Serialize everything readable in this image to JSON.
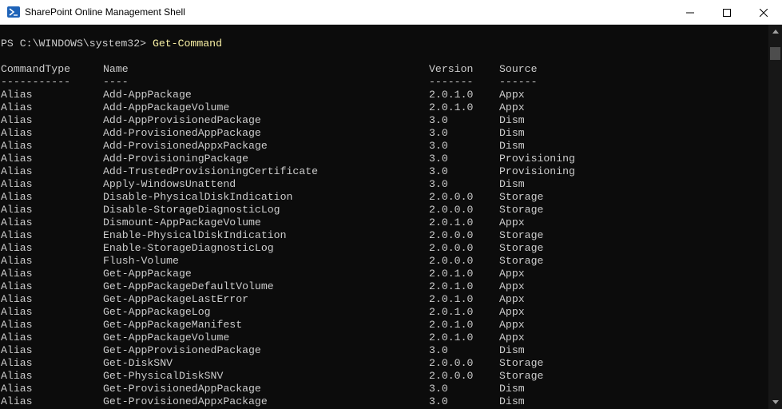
{
  "window": {
    "title": "SharePoint Online Management Shell"
  },
  "icons": {
    "app": "powershell-icon",
    "minimize": "minimize-icon",
    "maximize": "maximize-icon",
    "close": "close-icon"
  },
  "colors": {
    "console_bg": "#0c0c0c",
    "text": "#cccccc",
    "command": "#f9f1a5"
  },
  "console": {
    "prompt": "PS C:\\WINDOWS\\system32> ",
    "command": "Get-Command",
    "headers": {
      "type": "CommandType",
      "name": "Name",
      "version": "Version",
      "source": "Source"
    },
    "dividers": {
      "type": "-----------",
      "name": "----",
      "version": "-------",
      "source": "------"
    },
    "rows": [
      {
        "type": "Alias",
        "name": "Add-AppPackage",
        "version": "2.0.1.0",
        "source": "Appx"
      },
      {
        "type": "Alias",
        "name": "Add-AppPackageVolume",
        "version": "2.0.1.0",
        "source": "Appx"
      },
      {
        "type": "Alias",
        "name": "Add-AppProvisionedPackage",
        "version": "3.0",
        "source": "Dism"
      },
      {
        "type": "Alias",
        "name": "Add-ProvisionedAppPackage",
        "version": "3.0",
        "source": "Dism"
      },
      {
        "type": "Alias",
        "name": "Add-ProvisionedAppxPackage",
        "version": "3.0",
        "source": "Dism"
      },
      {
        "type": "Alias",
        "name": "Add-ProvisioningPackage",
        "version": "3.0",
        "source": "Provisioning"
      },
      {
        "type": "Alias",
        "name": "Add-TrustedProvisioningCertificate",
        "version": "3.0",
        "source": "Provisioning"
      },
      {
        "type": "Alias",
        "name": "Apply-WindowsUnattend",
        "version": "3.0",
        "source": "Dism"
      },
      {
        "type": "Alias",
        "name": "Disable-PhysicalDiskIndication",
        "version": "2.0.0.0",
        "source": "Storage"
      },
      {
        "type": "Alias",
        "name": "Disable-StorageDiagnosticLog",
        "version": "2.0.0.0",
        "source": "Storage"
      },
      {
        "type": "Alias",
        "name": "Dismount-AppPackageVolume",
        "version": "2.0.1.0",
        "source": "Appx"
      },
      {
        "type": "Alias",
        "name": "Enable-PhysicalDiskIndication",
        "version": "2.0.0.0",
        "source": "Storage"
      },
      {
        "type": "Alias",
        "name": "Enable-StorageDiagnosticLog",
        "version": "2.0.0.0",
        "source": "Storage"
      },
      {
        "type": "Alias",
        "name": "Flush-Volume",
        "version": "2.0.0.0",
        "source": "Storage"
      },
      {
        "type": "Alias",
        "name": "Get-AppPackage",
        "version": "2.0.1.0",
        "source": "Appx"
      },
      {
        "type": "Alias",
        "name": "Get-AppPackageDefaultVolume",
        "version": "2.0.1.0",
        "source": "Appx"
      },
      {
        "type": "Alias",
        "name": "Get-AppPackageLastError",
        "version": "2.0.1.0",
        "source": "Appx"
      },
      {
        "type": "Alias",
        "name": "Get-AppPackageLog",
        "version": "2.0.1.0",
        "source": "Appx"
      },
      {
        "type": "Alias",
        "name": "Get-AppPackageManifest",
        "version": "2.0.1.0",
        "source": "Appx"
      },
      {
        "type": "Alias",
        "name": "Get-AppPackageVolume",
        "version": "2.0.1.0",
        "source": "Appx"
      },
      {
        "type": "Alias",
        "name": "Get-AppProvisionedPackage",
        "version": "3.0",
        "source": "Dism"
      },
      {
        "type": "Alias",
        "name": "Get-DiskSNV",
        "version": "2.0.0.0",
        "source": "Storage"
      },
      {
        "type": "Alias",
        "name": "Get-PhysicalDiskSNV",
        "version": "2.0.0.0",
        "source": "Storage"
      },
      {
        "type": "Alias",
        "name": "Get-ProvisionedAppPackage",
        "version": "3.0",
        "source": "Dism"
      },
      {
        "type": "Alias",
        "name": "Get-ProvisionedAppxPackage",
        "version": "3.0",
        "source": "Dism"
      }
    ]
  }
}
